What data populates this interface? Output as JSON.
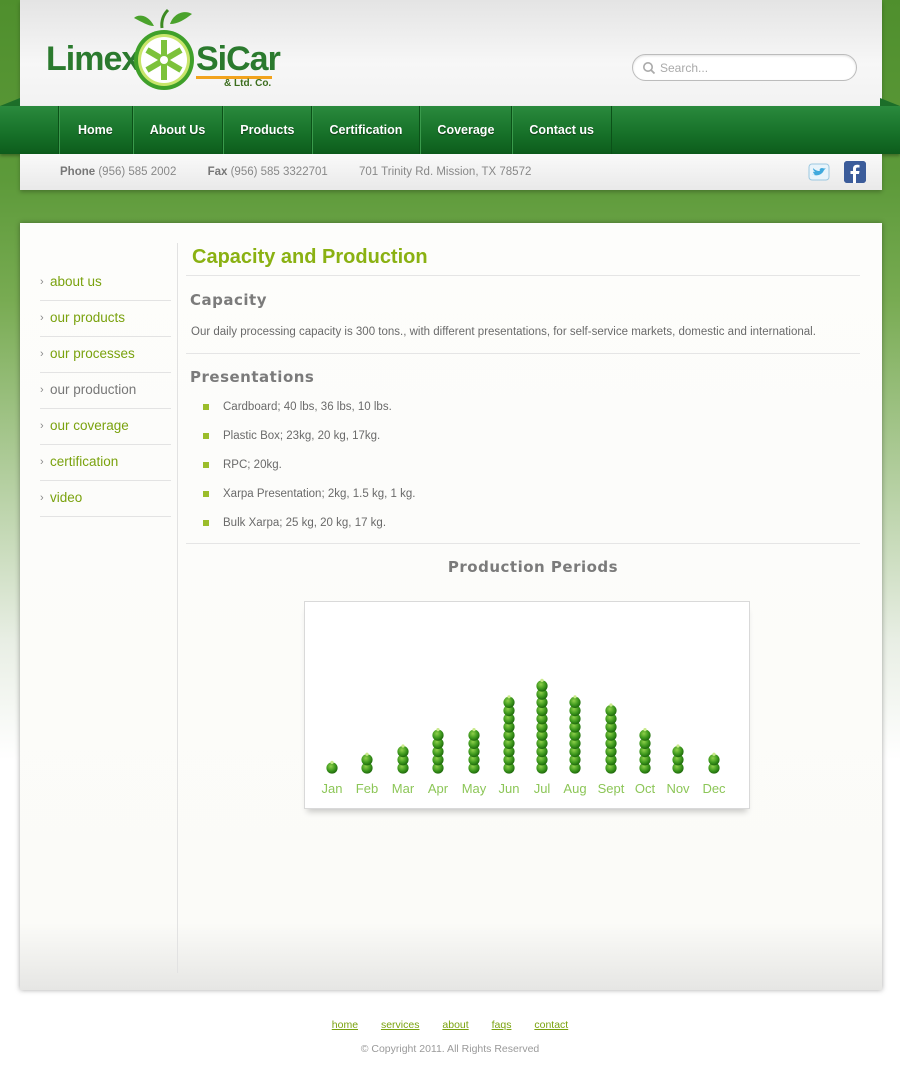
{
  "brand": {
    "name_part1": "Limex",
    "name_part2": "SiCar",
    "suffix": "& Ltd. Co.",
    "colors": {
      "green": "#2b7a2e",
      "accent": "#8ab112",
      "orange": "#f2a31d"
    }
  },
  "search": {
    "placeholder": "Search...",
    "value": "",
    "icon": "search-icon"
  },
  "nav": {
    "items": [
      {
        "label": "Home"
      },
      {
        "label": "About Us"
      },
      {
        "label": "Products"
      },
      {
        "label": "Certification"
      },
      {
        "label": "Coverage"
      },
      {
        "label": "Contact us"
      }
    ]
  },
  "contact": {
    "phone_label": "Phone",
    "phone": "(956) 585 2002",
    "fax_label": "Fax",
    "fax": "(956) 585 3322701",
    "address": "701 Trinity Rd. Mission, TX 78572",
    "social_icons": [
      "twitter-icon",
      "facebook-icon"
    ]
  },
  "sidebar": {
    "items": [
      {
        "label": "about us",
        "active": false
      },
      {
        "label": "our products",
        "active": false
      },
      {
        "label": "our processes",
        "active": false
      },
      {
        "label": "our production",
        "active": true
      },
      {
        "label": "our coverage",
        "active": false
      },
      {
        "label": "certification",
        "active": false
      },
      {
        "label": "video",
        "active": false
      }
    ]
  },
  "content": {
    "title": "Capacity and Production",
    "capacity_heading": "Capacity",
    "capacity_text": "Our daily processing capacity is 300 tons., with different presentations, for self-service markets, domestic and international.",
    "presentations_heading": "Presentations",
    "presentations": [
      "Cardboard; 40 lbs, 36 lbs, 10 lbs.",
      "Plastic Box; 23kg, 20 kg, 17kg.",
      "RPC; 20kg.",
      "Xarpa Presentation; 2kg, 1.5 kg, 1 kg.",
      "Bulk Xarpa; 25 kg, 20 kg, 17 kg."
    ],
    "chart_heading": "Production Periods"
  },
  "chart_data": {
    "type": "bar",
    "title": "Production Periods",
    "categories": [
      "Jan",
      "Feb",
      "Mar",
      "Apr",
      "May",
      "Jun",
      "Jul",
      "Aug",
      "Sept",
      "Oct",
      "Nov",
      "Dec"
    ],
    "values": [
      1,
      2,
      3,
      5,
      5,
      9,
      11,
      9,
      8,
      5,
      3,
      2
    ],
    "xlabel": "",
    "ylabel": "",
    "grid": false,
    "mark_color": "#3f9a1e"
  },
  "footer": {
    "links": [
      {
        "label": "home"
      },
      {
        "label": "services"
      },
      {
        "label": "about"
      },
      {
        "label": "faqs"
      },
      {
        "label": "contact"
      }
    ],
    "copyright": "© Copyright 2011. All Rights Reserved"
  }
}
